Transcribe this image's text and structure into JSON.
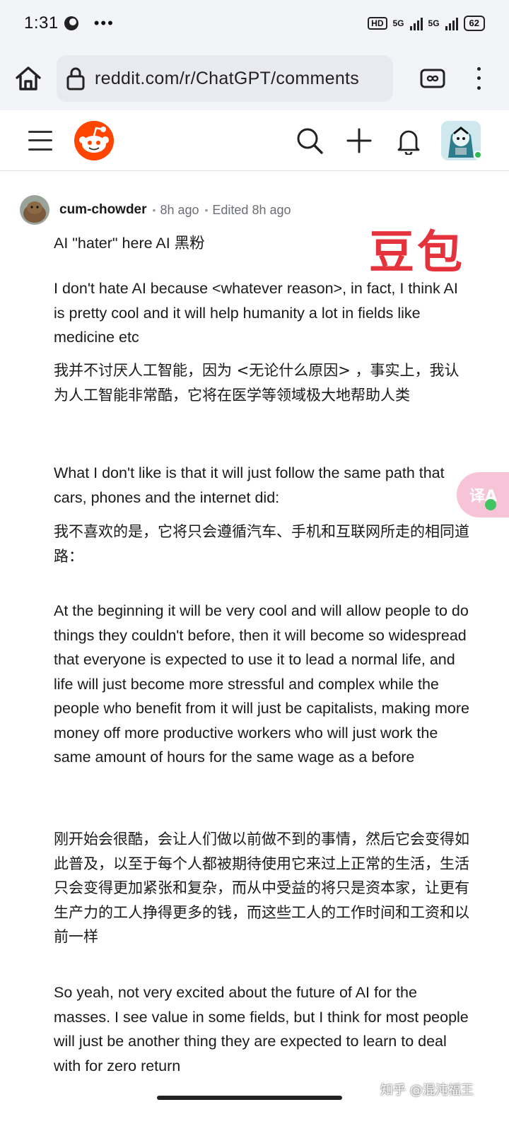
{
  "status_bar": {
    "time": "1:31",
    "more": "•••",
    "hd_badge": "HD",
    "network_1": "5G",
    "network_2": "5G",
    "battery": "62"
  },
  "browser": {
    "url": "reddit.com/r/ChatGPT/comments",
    "home_icon": "home-icon",
    "lock_icon": "lock-icon",
    "tabs_icon": "tabs-icon",
    "menu_icon": "more-vertical-icon"
  },
  "reddit_header": {
    "menu_icon": "hamburger-icon",
    "logo_icon": "reddit-snoo-icon",
    "search_icon": "search-icon",
    "create_icon": "plus-icon",
    "notifications_icon": "bell-icon"
  },
  "comment": {
    "username": "cum-chowder",
    "time": "8h ago",
    "edited": "Edited 8h ago",
    "overlay_stamp": "豆包",
    "paragraphs": [
      "AI \"hater\" here  AI 黑粉",
      "I don't hate AI because <whatever reason>, in fact, I think AI is pretty cool and it will help humanity a lot in fields like medicine etc",
      "我并不讨厌人工智能，因为 <无论什么原因> ，事实上，我认为人工智能非常酷，它将在医学等领域极大地帮助人类",
      "What I don't like is that it will just follow the same path that cars, phones and the internet did:",
      "我不喜欢的是，它将只会遵循汽车、手机和互联网所走的相同道路：",
      "At the beginning it will be very cool and will allow people to do things they couldn't before, then it will become so widespread that everyone is expected to use it to lead a normal life, and life will just become more stressful and complex while the people who benefit from it will just be capitalists, making more money off more productive workers who will just work the same amount of hours for the same wage as a before",
      "刚开始会很酷，会让人们做以前做不到的事情，然后它会变得如此普及，以至于每个人都被期待使用它来过上正常的生活，生活只会变得更加紧张和复杂，而从中受益的将只是资本家，让更有生产力的工人挣得更多的钱，而这些工人的工作时间和工资和以前一样",
      "So yeah, not very excited about the future of AI for the masses. I see value in some fields, but I think for most people will just be another thing they are expected to learn to deal with for zero return"
    ]
  },
  "translate_fab": {
    "label": "译A"
  },
  "watermark": "知乎 @混沌福王"
}
